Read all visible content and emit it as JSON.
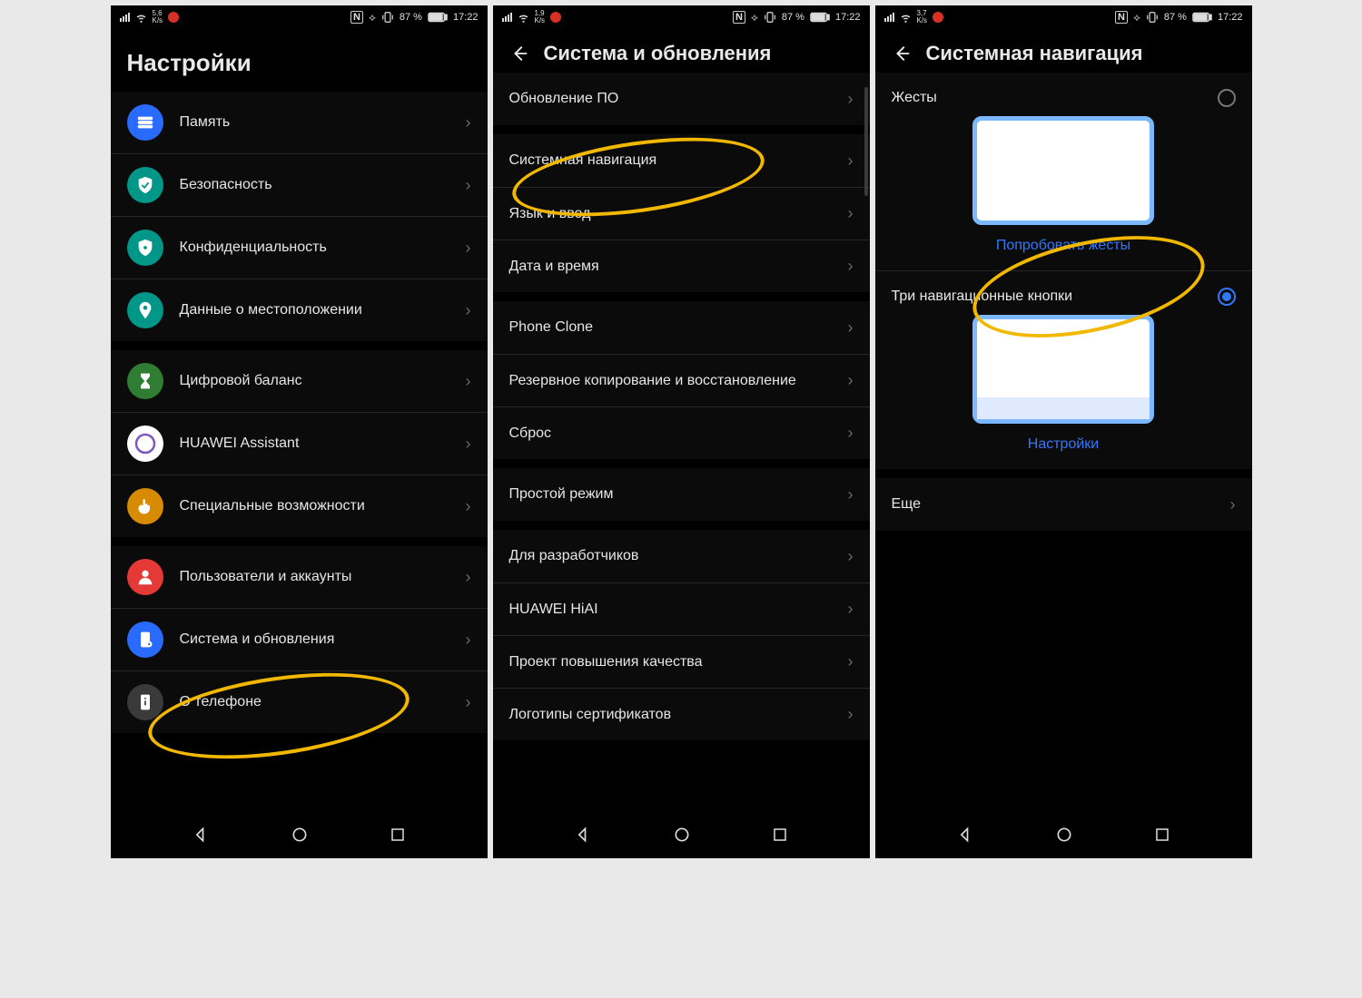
{
  "status": {
    "battery": "87 %",
    "time": "17:22"
  },
  "ks": [
    "5,6",
    "1,9",
    "3,7"
  ],
  "screen1": {
    "title": "Настройки",
    "groups": [
      [
        {
          "icon": "storage",
          "bg": "#2a6bff",
          "label": "Память"
        },
        {
          "icon": "shield-check",
          "bg": "#009688",
          "label": "Безопасность"
        },
        {
          "icon": "shield-lock",
          "bg": "#009688",
          "label": "Конфиденциальность"
        },
        {
          "icon": "location",
          "bg": "#009688",
          "label": "Данные о местоположении"
        }
      ],
      [
        {
          "icon": "hourglass",
          "bg": "#2e7d32",
          "label": "Цифровой баланс"
        },
        {
          "icon": "assistant",
          "bg": "#ffffff",
          "label": "HUAWEI Assistant"
        },
        {
          "icon": "hand",
          "bg": "#d68b00",
          "label": "Специальные возможности"
        }
      ],
      [
        {
          "icon": "user",
          "bg": "#e53935",
          "label": "Пользователи и аккаунты"
        },
        {
          "icon": "phone-cog",
          "bg": "#2a6bff",
          "label": "Система и обновления"
        },
        {
          "icon": "phone-info",
          "bg": "#3a3a3a",
          "label": "О телефоне"
        }
      ]
    ]
  },
  "screen2": {
    "title": "Система и обновления",
    "groups": [
      [
        "Обновление ПО"
      ],
      [
        "Системная навигация",
        "Язык и ввод",
        "Дата и время"
      ],
      [
        "Phone Clone",
        "Резервное копирование и восстановление",
        "Сброс"
      ],
      [
        "Простой режим"
      ],
      [
        "Для разработчиков",
        "HUAWEI HiAI",
        "Проект повышения качества",
        "Логотипы сертификатов"
      ]
    ]
  },
  "screen3": {
    "title": "Системная навигация",
    "opt_gestures": "Жесты",
    "try_gestures": "Попробовать жесты",
    "opt_three": "Три навигационные кнопки",
    "settings": "Настройки",
    "more": "Еще"
  }
}
